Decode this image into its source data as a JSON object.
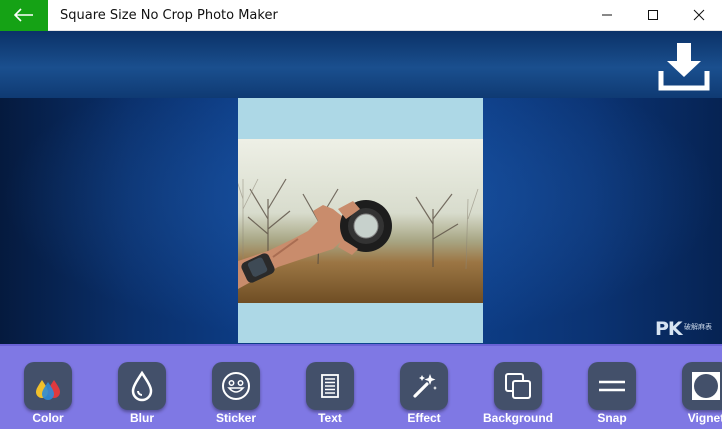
{
  "window": {
    "title": "Square Size No Crop Photo Maker",
    "back_icon": "arrow-left-icon",
    "back_color": "#15a215"
  },
  "canvas": {
    "download_icon": "download-icon",
    "square_background": "#add8e6",
    "watermark": "PK",
    "watermark_sub": "破解麻表"
  },
  "toolbar": {
    "background": "#7f78e4",
    "tools": [
      {
        "label": "Color",
        "icon": "color-drops-icon"
      },
      {
        "label": "Blur",
        "icon": "blur-drop-icon"
      },
      {
        "label": "Sticker",
        "icon": "smiley-icon"
      },
      {
        "label": "Text",
        "icon": "document-text-icon"
      },
      {
        "label": "Effect",
        "icon": "magic-wand-icon"
      },
      {
        "label": "Background",
        "icon": "layers-icon"
      },
      {
        "label": "Snap",
        "icon": "snap-lines-icon"
      },
      {
        "label": "Vignet",
        "icon": "vignette-icon"
      }
    ]
  }
}
